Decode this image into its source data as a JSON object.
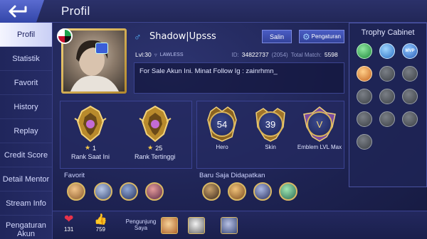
{
  "header": {
    "title": "Profil"
  },
  "sidebar": {
    "items": [
      {
        "label": "Profil",
        "active": true
      },
      {
        "label": "Statistik"
      },
      {
        "label": "Favorit"
      },
      {
        "label": "History"
      },
      {
        "label": "Replay"
      },
      {
        "label": "Credit Score"
      },
      {
        "label": "Detail Mentor"
      },
      {
        "label": "Stream Info"
      },
      {
        "label": "Pengaturan Akun"
      }
    ]
  },
  "profile": {
    "nickname": "Shadow|Upsss",
    "level": "Lvl:30",
    "tier": "LAWLESS",
    "id_label": "ID:",
    "id": "34822737",
    "server": "(2054)",
    "total_match_label": "Total Match:",
    "total_match": "5598",
    "bio": "For Sale Akun Ini. Minat Follow Ig : zainrhmn_",
    "copy_label": "Salin",
    "settings_label": "Pengaturan"
  },
  "ranks": [
    {
      "label": "Rank Saat Ini",
      "stars": "1"
    },
    {
      "label": "Rank Tertinggi",
      "stars": "25"
    }
  ],
  "medals": [
    {
      "label": "Hero",
      "value": "54"
    },
    {
      "label": "Skin",
      "value": "39"
    },
    {
      "label": "Emblem LVL Max",
      "value": "V"
    }
  ],
  "favorit": {
    "title": "Favorit"
  },
  "recent": {
    "title": "Baru Saja Didapatkan"
  },
  "trophy": {
    "title": "Trophy Cabinet",
    "mvp_text": "MVP"
  },
  "bottom": {
    "likes": "131",
    "thumbs": "759",
    "visitors_label": "Pengunjung Saya"
  },
  "colors": {
    "accent": "#d9b865",
    "sidebar_active": "#f4f5ff",
    "button": "#3d4fb4"
  }
}
